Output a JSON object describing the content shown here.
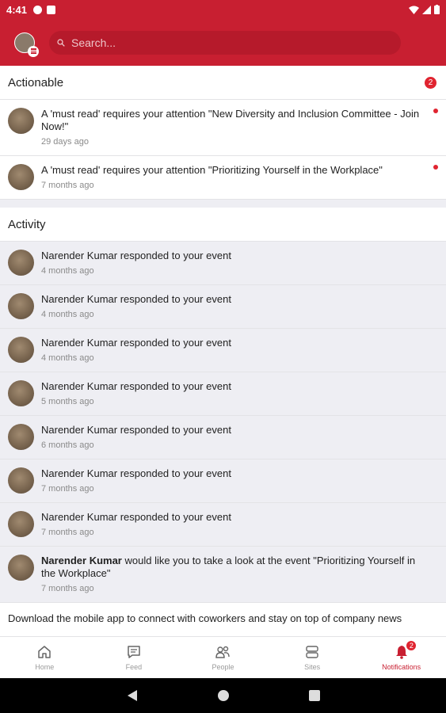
{
  "status_bar": {
    "time": "4:41"
  },
  "header": {
    "search_placeholder": "Search...",
    "brand_color": "#c81f31"
  },
  "actionable": {
    "title": "Actionable",
    "count": "2",
    "items": [
      {
        "text": "A 'must read' requires your attention \"New Diversity and Inclusion Committee - Join Now!\"",
        "time": "29 days ago"
      },
      {
        "text": "A 'must read' requires your attention \"Prioritizing Yourself in the Workplace\"",
        "time": "7 months ago"
      }
    ]
  },
  "activity": {
    "title": "Activity",
    "items": [
      {
        "name": "Narender Kumar",
        "action": " responded to your event",
        "time": "4 months ago"
      },
      {
        "name": "Narender Kumar",
        "action": " responded to your event",
        "time": "4 months ago"
      },
      {
        "name": "Narender Kumar",
        "action": " responded to your event",
        "time": "4 months ago"
      },
      {
        "name": "Narender Kumar",
        "action": " responded to your event",
        "time": "5 months ago"
      },
      {
        "name": "Narender Kumar",
        "action": " responded to your event",
        "time": "6 months ago"
      },
      {
        "name": "Narender Kumar",
        "action": " responded to your event",
        "time": "7 months ago"
      },
      {
        "name": "Narender Kumar",
        "action": " responded to your event",
        "time": "7 months ago"
      },
      {
        "name": "Narender Kumar",
        "action": " would like you to take a look at the event \"Prioritizing Yourself in the Workplace\"",
        "time": "7 months ago"
      }
    ]
  },
  "download_banner": {
    "text": "Download the mobile app to connect with coworkers and stay on top of company news"
  },
  "bottom_nav": {
    "items": [
      {
        "label": "Home",
        "icon": "home-icon"
      },
      {
        "label": "Feed",
        "icon": "feed-icon"
      },
      {
        "label": "People",
        "icon": "people-icon"
      },
      {
        "label": "Sites",
        "icon": "sites-icon"
      },
      {
        "label": "Notifications",
        "icon": "bell-icon",
        "badge": "2",
        "active": true
      }
    ]
  }
}
